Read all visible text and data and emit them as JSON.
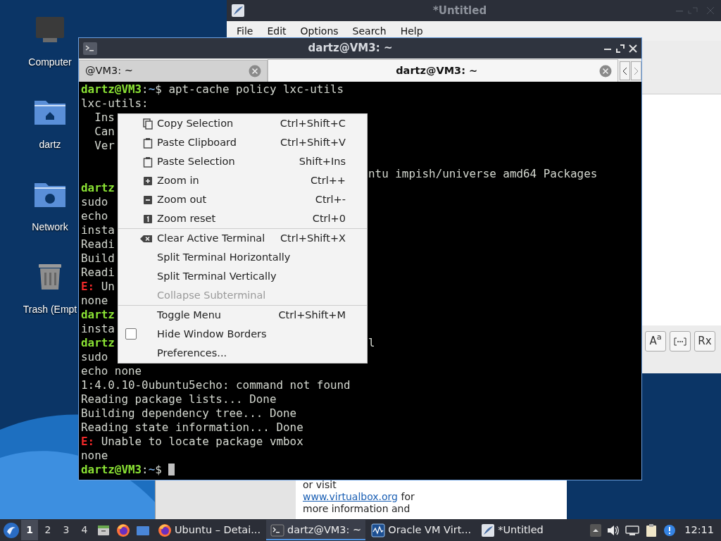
{
  "desktop": {
    "icons": [
      {
        "kind": "computer",
        "label": "Computer"
      },
      {
        "kind": "home",
        "label": "dartz"
      },
      {
        "kind": "network",
        "label": "Network"
      },
      {
        "kind": "trash",
        "label": "Trash (Empt"
      }
    ]
  },
  "editor_window": {
    "title": "*Untitled",
    "menu": [
      "File",
      "Edit",
      "Options",
      "Search",
      "Help"
    ],
    "tool_buttons": [
      {
        "kind": "text",
        "label": "A$^{a}$"
      },
      {
        "kind": "icon"
      },
      {
        "kind": "text",
        "label": "Rx"
      }
    ]
  },
  "browser_window": {
    "lines": [
      {
        "kind": "plain",
        "text": "or visit"
      },
      {
        "kind": "link",
        "link": "www.virtualbox.org",
        "text": " for"
      },
      {
        "kind": "plain",
        "text": "more information and"
      }
    ]
  },
  "terminal_window": {
    "title": "dartz@VM3: ~",
    "tabs": [
      {
        "label": "@VM3: ~",
        "selected": false
      },
      {
        "label": "dartz@VM3: ~",
        "selected": true
      }
    ],
    "lines": [
      {
        "parts": [
          {
            "kind": "user",
            "text": "dartz@VM3"
          },
          {
            "kind": "text",
            "text": ":"
          },
          {
            "kind": "path",
            "text": "~"
          },
          {
            "kind": "text",
            "text": "$ apt-cache policy lxc-utils"
          }
        ]
      },
      {
        "parts": [
          {
            "kind": "text",
            "text": "lxc-utils:"
          }
        ]
      },
      {
        "parts": [
          {
            "kind": "text",
            "text": "  Ins"
          }
        ]
      },
      {
        "parts": [
          {
            "kind": "text",
            "text": "  Can"
          }
        ]
      },
      {
        "parts": [
          {
            "kind": "text",
            "text": "  Ver"
          }
        ]
      },
      {
        "tail": "ntu impish/universe amd64 Packages"
      },
      {
        "parts": [
          {
            "kind": "user",
            "text": "dartz"
          }
        ]
      },
      {
        "parts": [
          {
            "kind": "text",
            "text": "sudo"
          }
        ]
      },
      {
        "parts": [
          {
            "kind": "text",
            "text": "echo"
          }
        ]
      },
      {
        "parts": [
          {
            "kind": "text",
            "text": "insta"
          }
        ]
      },
      {
        "parts": [
          {
            "kind": "text",
            "text": "Readi"
          }
        ]
      },
      {
        "parts": [
          {
            "kind": "text",
            "text": "Build"
          }
        ]
      },
      {
        "parts": [
          {
            "kind": "text",
            "text": "Readi"
          }
        ]
      },
      {
        "parts": [
          {
            "kind": "error",
            "text": "E:"
          },
          {
            "kind": "text",
            "text": " Un"
          }
        ]
      },
      {
        "parts": [
          {
            "kind": "text",
            "text": "none"
          }
        ]
      },
      {
        "parts": [
          {
            "kind": "user",
            "text": "dartz"
          }
        ]
      },
      {
        "parts": [
          {
            "kind": "text",
            "text": "insta"
          }
        ]
      },
      {
        "parts": [
          {
            "kind": "user",
            "text": "dartz"
          }
        ],
        "tail": "l"
      },
      {
        "parts": [
          {
            "kind": "text",
            "text": "sudo"
          }
        ]
      },
      {
        "parts": [
          {
            "kind": "text",
            "text": "echo none"
          }
        ]
      },
      {
        "parts": [
          {
            "kind": "text",
            "text": "1:4.0.10-0ubuntu5echo: command not found"
          }
        ]
      },
      {
        "parts": [
          {
            "kind": "text",
            "text": "Reading package lists... Done"
          }
        ]
      },
      {
        "parts": [
          {
            "kind": "text",
            "text": "Building dependency tree... Done"
          }
        ]
      },
      {
        "parts": [
          {
            "kind": "text",
            "text": "Reading state information... Done"
          }
        ]
      },
      {
        "parts": [
          {
            "kind": "error",
            "text": "E:"
          },
          {
            "kind": "text",
            "text": " Unable to locate package vmbox"
          }
        ]
      },
      {
        "parts": [
          {
            "kind": "text",
            "text": "none"
          }
        ]
      },
      {
        "parts": [
          {
            "kind": "user",
            "text": "dartz@VM3"
          },
          {
            "kind": "text",
            "text": ":"
          },
          {
            "kind": "path",
            "text": "~"
          },
          {
            "kind": "text",
            "text": "$ "
          }
        ],
        "cursor": true
      }
    ]
  },
  "context_menu": {
    "groups": [
      [
        {
          "kind": "copy",
          "label": "Copy Selection",
          "shortcut": "Ctrl+Shift+C",
          "disabled": false
        },
        {
          "kind": "paste",
          "label": "Paste Clipboard",
          "shortcut": "Ctrl+Shift+V",
          "disabled": false
        },
        {
          "kind": "paste",
          "label": "Paste Selection",
          "shortcut": "Shift+Ins",
          "disabled": false
        },
        {
          "kind": "zoom-in",
          "label": "Zoom in",
          "shortcut": "Ctrl++",
          "disabled": false
        },
        {
          "kind": "zoom-out",
          "label": "Zoom out",
          "shortcut": "Ctrl+-",
          "disabled": false
        },
        {
          "kind": "zoom-reset",
          "label": "Zoom reset",
          "shortcut": "Ctrl+0",
          "disabled": false
        }
      ],
      [
        {
          "kind": "clear",
          "label": "Clear Active Terminal",
          "shortcut": "Ctrl+Shift+X",
          "disabled": false
        },
        {
          "kind": "plain",
          "label": "Split Terminal Horizontally",
          "disabled": false
        },
        {
          "kind": "plain",
          "label": "Split Terminal Vertically",
          "disabled": false
        },
        {
          "kind": "plain",
          "label": "Collapse Subterminal",
          "disabled": true
        }
      ],
      [
        {
          "kind": "plain",
          "label": "Toggle Menu",
          "shortcut": "Ctrl+Shift+M",
          "disabled": false
        },
        {
          "kind": "checkbox",
          "label": "Hide Window Borders",
          "checked": false,
          "disabled": false
        },
        {
          "kind": "plain",
          "label": "Preferences...",
          "disabled": false
        }
      ]
    ]
  },
  "taskbar": {
    "workspaces": [
      {
        "label": "1",
        "selected": true
      },
      {
        "label": "2",
        "selected": false
      },
      {
        "label": "3",
        "selected": false
      },
      {
        "label": "4",
        "selected": false
      }
    ],
    "launchers": [
      {
        "kind": "files"
      },
      {
        "kind": "firefox"
      },
      {
        "kind": "desktop"
      }
    ],
    "tasks": [
      {
        "kind": "firefox",
        "label": "Ubuntu – Detai...",
        "selected": false
      },
      {
        "kind": "terminal",
        "label": "dartz@VM3: ~",
        "selected": true
      },
      {
        "kind": "vbox",
        "label": "Oracle VM Virt...",
        "selected": false
      },
      {
        "kind": "editor",
        "label": "*Untitled",
        "selected": false
      }
    ],
    "clock": "12:11"
  }
}
